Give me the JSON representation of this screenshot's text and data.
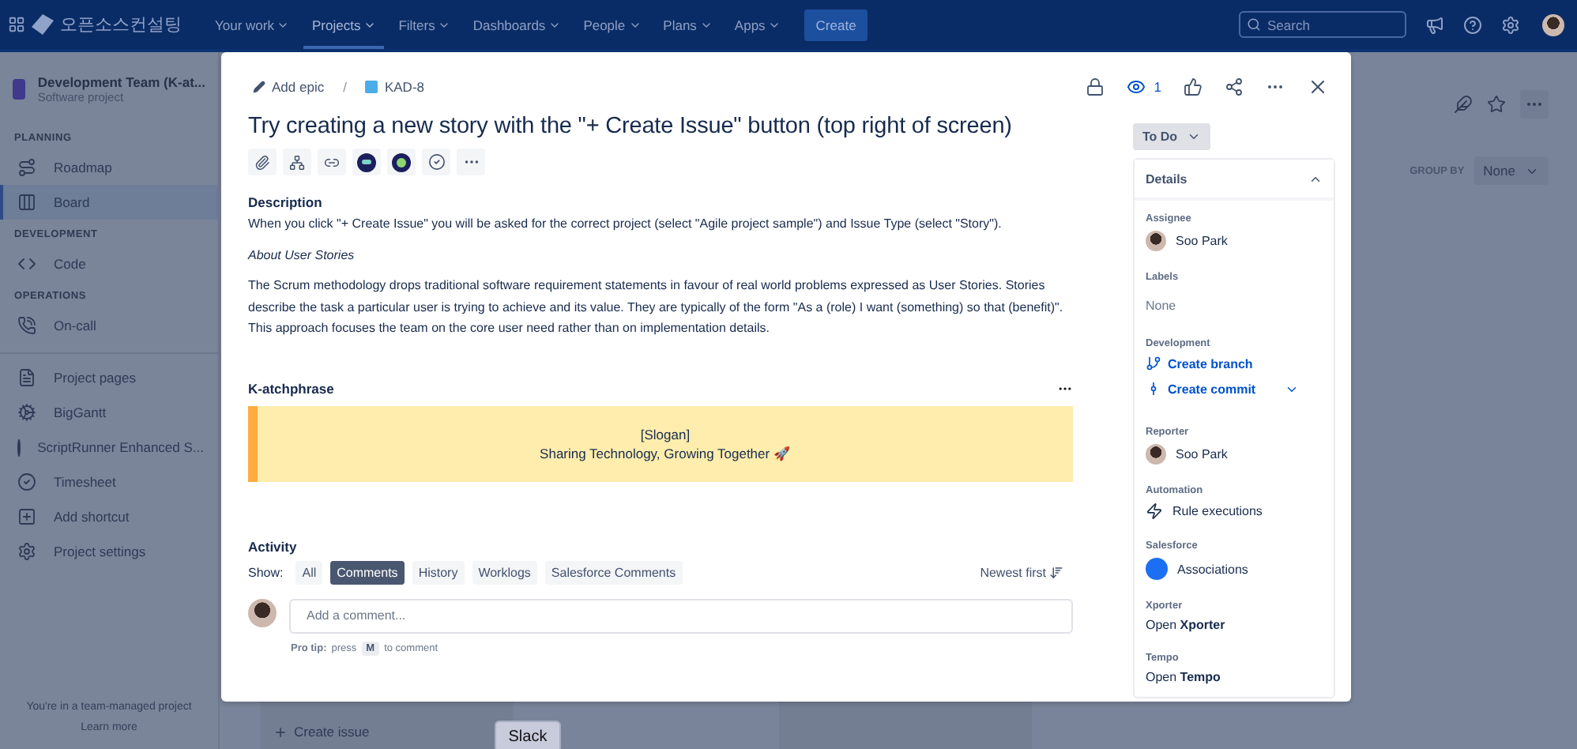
{
  "nav": {
    "brand": "오픈소스컨설팅",
    "items": [
      {
        "label": "Your work",
        "selected": false
      },
      {
        "label": "Projects",
        "selected": true
      },
      {
        "label": "Filters",
        "selected": false
      },
      {
        "label": "Dashboards",
        "selected": false
      },
      {
        "label": "People",
        "selected": false
      },
      {
        "label": "Plans",
        "selected": false
      },
      {
        "label": "Apps",
        "selected": false
      }
    ],
    "create": "Create",
    "search": {
      "placeholder": "Search"
    }
  },
  "sidebar": {
    "project": "Development Team (K-at...",
    "subtitle": "Software project",
    "sections": [
      {
        "heading": "PLANNING",
        "items": [
          {
            "label": "Roadmap",
            "selected": false
          },
          {
            "label": "Board",
            "selected": true
          }
        ]
      },
      {
        "heading": "DEVELOPMENT",
        "items": [
          {
            "label": "Code",
            "selected": false
          }
        ]
      },
      {
        "heading": "OPERATIONS",
        "items": [
          {
            "label": "On-call",
            "selected": false
          }
        ]
      },
      {
        "items": [
          {
            "label": "Project pages",
            "selected": false
          },
          {
            "label": "BigGantt",
            "selected": false
          },
          {
            "label": "ScriptRunner Enhanced S...",
            "selected": false
          },
          {
            "label": "Timesheet",
            "selected": false
          },
          {
            "label": "Add shortcut",
            "selected": false
          },
          {
            "label": "Project settings",
            "selected": false
          }
        ]
      }
    ],
    "footer": "You're in a team-managed project",
    "learn_more": "Learn more"
  },
  "board": {
    "group_by": "GROUP BY",
    "group_value": "None",
    "create_issue": "Create issue",
    "slack": "Slack"
  },
  "issue": {
    "add_epic": "Add epic",
    "separator": "/",
    "key": "KAD-8",
    "watchers": "1",
    "title": "Try creating a new story with the \"+ Create Issue\" button (top right of screen)",
    "description": {
      "heading": "Description",
      "paragraphs": [
        {
          "kind": "plain",
          "text": "When you click \"+ Create Issue\" you will be asked for the correct project (select \"Agile project sample\") and Issue Type (select \"Story\")."
        },
        {
          "kind": "italic",
          "text": "About User Stories"
        },
        {
          "kind": "plain",
          "text": "The Scrum methodology drops traditional software requirement statements in favour of real world problems expressed as User Stories. Stories describe the task a particular user is trying to achieve and its value. They are typically of the form \"As a (role) I want (something) so that (benefit)\". This approach focuses the team on the core user need rather than on implementation details."
        }
      ]
    },
    "catchphrase": {
      "heading": "K-atchphrase",
      "lines": [
        "[Slogan]",
        "Sharing Technology, Growing Together 🚀"
      ]
    },
    "activity": {
      "heading": "Activity",
      "show": "Show:",
      "filters": [
        {
          "label": "All",
          "selected": false
        },
        {
          "label": "Comments",
          "selected": true
        },
        {
          "label": "History",
          "selected": false
        },
        {
          "label": "Worklogs",
          "selected": false
        },
        {
          "label": "Salesforce Comments",
          "selected": false
        }
      ],
      "sort": "Newest first",
      "comment": {
        "placeholder": "Add a comment..."
      },
      "tip": {
        "label": "Pro tip:",
        "before": "press",
        "key": "M",
        "after": "to comment"
      }
    },
    "status": "To Do",
    "details": {
      "heading": "Details",
      "expanded": true,
      "fields": [
        {
          "label": "Assignee",
          "kind": "user",
          "value": "Soo Park"
        },
        {
          "label": "Labels",
          "kind": "empty",
          "value": "None"
        },
        {
          "label": "Development",
          "kind": "links",
          "links": [
            "Create branch",
            "Create commit"
          ]
        },
        {
          "label": "Reporter",
          "kind": "user",
          "value": "Soo Park"
        },
        {
          "label": "Automation",
          "kind": "app",
          "value": "Rule executions"
        },
        {
          "label": "Salesforce",
          "kind": "app",
          "value": "Associations"
        },
        {
          "label": "Xporter",
          "kind": "rich",
          "value": "Open **Xporter**"
        },
        {
          "label": "Tempo",
          "kind": "rich",
          "value": "Open **Tempo**"
        }
      ]
    }
  }
}
